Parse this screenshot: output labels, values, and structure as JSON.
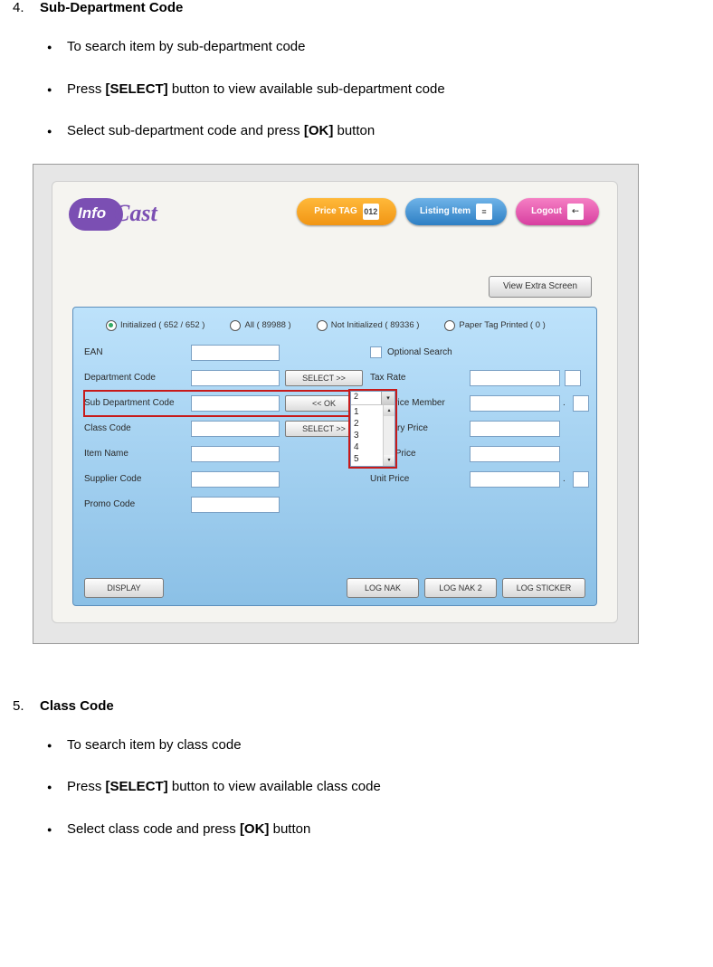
{
  "section4": {
    "num": "4.",
    "title": "Sub-Department Code",
    "bullets": [
      {
        "pre": "To search item by sub-department code"
      },
      {
        "pre": "Press ",
        "bold": "[SELECT]",
        "post": " button to view available sub-department code"
      },
      {
        "pre": "Select sub-department code and press ",
        "bold": "[OK]",
        "post": " button"
      }
    ]
  },
  "section5": {
    "num": "5.",
    "title": "Class Code",
    "bullets": [
      {
        "pre": "To search item by class code"
      },
      {
        "pre": "Press ",
        "bold": "[SELECT]",
        "post": " button to view available class code"
      },
      {
        "pre": "Select class code and press ",
        "bold": "[OK]",
        "post": " button"
      }
    ]
  },
  "shot": {
    "logo_text": "Cast",
    "pills": {
      "price": "Price TAG",
      "listing": "Listing Item",
      "logout": "Logout"
    },
    "view_extra": "View Extra Screen",
    "radios": {
      "initialized": "Initialized  ( 652 / 652 )",
      "all": "All  ( 89988 )",
      "not_initialized": "Not Initialized  ( 89336 )",
      "paper": "Paper Tag Printed  ( 0 )"
    },
    "left_labels": {
      "ean": "EAN",
      "dept": "Department Code",
      "subdept": "Sub Department Code",
      "classcode": "Class Code",
      "item": "Item Name",
      "supplier": "Supplier Code",
      "promo": "Promo Code"
    },
    "right_labels": {
      "optional": "Optional Search",
      "tax": "Tax Rate",
      "upm": "Unit Price Member",
      "ord": "Ordinary Price",
      "sales": "Sales Price",
      "unit": "Unit Price"
    },
    "buttons": {
      "select": "SELECT >>",
      "ok": "<< OK",
      "display": "DISPLAY",
      "lognak": "LOG NAK",
      "lognak2": "LOG NAK 2",
      "logsticker": "LOG STICKER"
    },
    "dropdown": {
      "selected": "2",
      "options": [
        "1",
        "2",
        "3",
        "4",
        "5"
      ]
    }
  }
}
